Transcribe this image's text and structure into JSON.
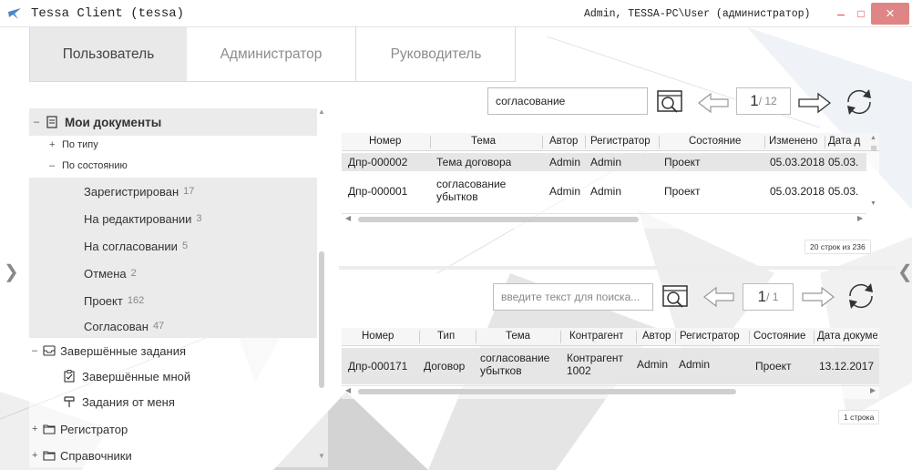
{
  "window": {
    "title": "Tessa Client (tessa)",
    "user": "Admin, TESSA-PC\\User (администратор)",
    "controls": {
      "minimize": "–",
      "maximize": "□",
      "close": "×"
    }
  },
  "tabs": [
    {
      "label": "Пользователь",
      "active": true
    },
    {
      "label": "Администратор",
      "active": false
    },
    {
      "label": "Руководитель",
      "active": false
    }
  ],
  "tree": {
    "my_docs": {
      "label": "Мои документы",
      "expander": "–"
    },
    "by_type": {
      "label": "По типу",
      "expander": "+"
    },
    "by_state": {
      "label": "По состоянию",
      "expander": "–"
    },
    "states": [
      {
        "label": "Зарегистрирован",
        "count": "17"
      },
      {
        "label": "На редактировании",
        "count": "3"
      },
      {
        "label": "На согласовании",
        "count": "5"
      },
      {
        "label": "Отмена",
        "count": "2"
      },
      {
        "label": "Проект",
        "count": "162"
      },
      {
        "label": "Согласован",
        "count": "47"
      }
    ],
    "completed_tasks": {
      "label": "Завершённые задания",
      "expander": "–"
    },
    "completed_by_me": {
      "label": "Завершённые мной"
    },
    "tasks_from_me": {
      "label": "Задания от меня"
    },
    "registrar": {
      "label": "Регистратор",
      "expander": "+"
    },
    "references": {
      "label": "Справочники",
      "expander": "+"
    }
  },
  "top_panel": {
    "search_value": "согласование",
    "page": "1",
    "total": "/ 12",
    "columns": [
      "Номер",
      "Тема",
      "Автор",
      "Регистратор",
      "Состояние",
      "Изменено",
      "Дата д"
    ],
    "rows": [
      [
        "Дпр-000002",
        "Тема договора",
        "Admin",
        "Admin",
        "Проект",
        "05.03.2018",
        "05.03."
      ],
      [
        "Дпр-000001",
        "согласование убытков",
        "Admin",
        "Admin",
        "Проект",
        "05.03.2018",
        "05.03."
      ]
    ],
    "row_count": "20 строк из 236"
  },
  "bottom_panel": {
    "search_placeholder": "введите текст для поиска...",
    "page": "1",
    "total": "/ 1",
    "columns": [
      "Номер",
      "Тип",
      "Тема",
      "Контрагент",
      "Автор",
      "Регистратор",
      "Состояние",
      "Дата докумен"
    ],
    "rows": [
      [
        "Дпр-000171",
        "Договор",
        "согласование убытков",
        "Контрагент 1002",
        "Admin",
        "Admin",
        "Проект",
        "13.12.2017"
      ]
    ],
    "row_count": "1 строка"
  },
  "colors": {
    "accent": "#e08585",
    "selection": "#e6e6e6",
    "logo": "#4a86c8"
  },
  "icons": [
    "tessa-logo-icon",
    "document-icon",
    "inbox-icon",
    "checklist-icon",
    "fork-icon",
    "folder-icon",
    "search-icon",
    "arrow-left-icon",
    "arrow-right-icon",
    "refresh-icon"
  ]
}
